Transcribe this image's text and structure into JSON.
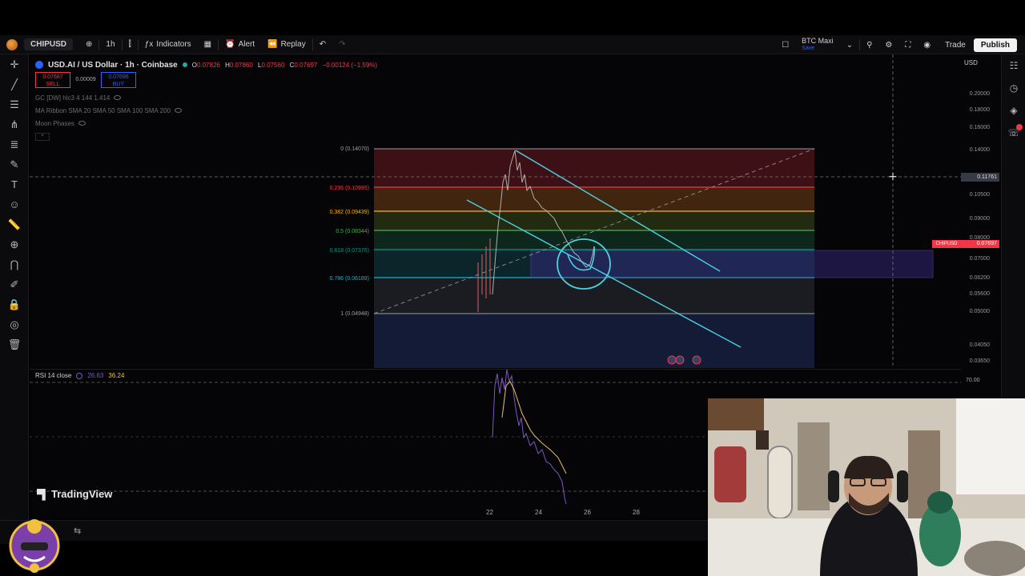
{
  "topbar": {
    "symbol": "CHIPUSD",
    "interval": "1h",
    "indicators": "Indicators",
    "alert": "Alert",
    "replay": "Replay",
    "layout_name": "BTC Maxi",
    "layout_sub": "Save",
    "trade": "Trade",
    "publish": "Publish"
  },
  "legend": {
    "title": "USD.AI / US Dollar · 1h · Coinbase",
    "ohlc": [
      {
        "label": "O",
        "value": "0.07826"
      },
      {
        "label": "H",
        "value": "0.07860"
      },
      {
        "label": "L",
        "value": "0.07560"
      },
      {
        "label": "C",
        "value": "0.07697"
      }
    ],
    "change": "−0.00124 (−1.59%)",
    "sell_price": "0.07687",
    "sell_label": "SELL",
    "spread": "0.00009",
    "buy_price": "0.07696",
    "buy_label": "BUY",
    "indicators": [
      "GC [DW] hlc3 4 144 1.414",
      "MA Ribbon SMA 20 SMA 50 SMA 100 SMA 200",
      "Moon Phases"
    ]
  },
  "fib_levels": [
    {
      "ratio": "0",
      "price": "0.14070",
      "label": "0 (0.14070)",
      "color": "#9e9e9e"
    },
    {
      "ratio": "0.236",
      "price": "0.10995",
      "label": "0.236 (0.10995)",
      "color": "#f23645"
    },
    {
      "ratio": "0.382",
      "price": "0.09439",
      "label": "0.382 (0.09439)",
      "color": "#ffb300"
    },
    {
      "ratio": "0.5",
      "price": "0.08344",
      "label": "0.5 (0.08344)",
      "color": "#4caf50"
    },
    {
      "ratio": "0.618",
      "price": "0.07376",
      "label": "0.618 (0.07376)",
      "color": "#089981"
    },
    {
      "ratio": "0.786",
      "price": "0.06189",
      "label": "0.786 (0.06189)",
      "color": "#00bcd4"
    },
    {
      "ratio": "1",
      "price": "0.04948",
      "label": "1 (0.04948)",
      "color": "#9e9e9e"
    }
  ],
  "price_scale": {
    "currency": "USD",
    "ticks": [
      "0.20000",
      "0.18000",
      "0.16000",
      "0.14000",
      "0.10500",
      "0.09000",
      "0.08000",
      "0.07000",
      "0.06200",
      "0.05600",
      "0.05000",
      "0.04050",
      "0.03650"
    ],
    "crosshair_price": "0.11761",
    "last_symbol": "CHIPUSD",
    "last_price": "0.07697",
    "rsi_level": "70.00"
  },
  "rsi": {
    "label": "RSI 14 close",
    "value_rsi": "26.63",
    "value_ma": "36.24"
  },
  "time_axis": [
    "22",
    "24",
    "26",
    "28"
  ],
  "brand": "TradingView",
  "colors": {
    "accent_blue": "#2962ff",
    "down_red": "#f23645",
    "trendline_cyan": "#4dd0e1",
    "rsi_purple": "#7e57c2",
    "rsi_ma_yellow": "#e8c15a"
  }
}
